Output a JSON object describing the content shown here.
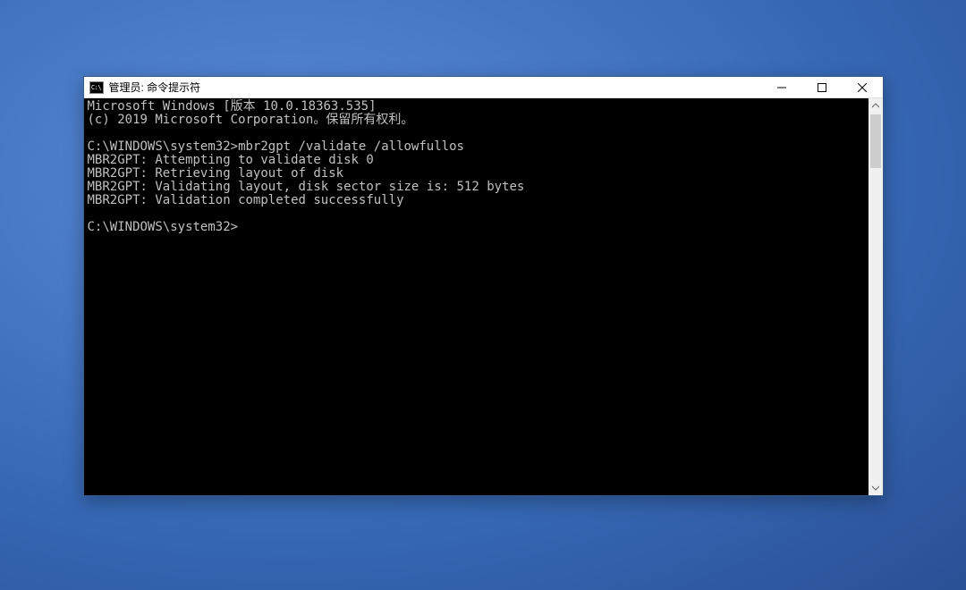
{
  "titlebar": {
    "icon_text": "C:\\",
    "title": "管理员: 命令提示符"
  },
  "terminal": {
    "lines": [
      "Microsoft Windows [版本 10.0.18363.535]",
      "(c) 2019 Microsoft Corporation。保留所有权利。",
      "",
      "C:\\WINDOWS\\system32>mbr2gpt /validate /allowfullos",
      "MBR2GPT: Attempting to validate disk 0",
      "MBR2GPT: Retrieving layout of disk",
      "MBR2GPT: Validating layout, disk sector size is: 512 bytes",
      "MBR2GPT: Validation completed successfully",
      "",
      "C:\\WINDOWS\\system32>"
    ]
  }
}
